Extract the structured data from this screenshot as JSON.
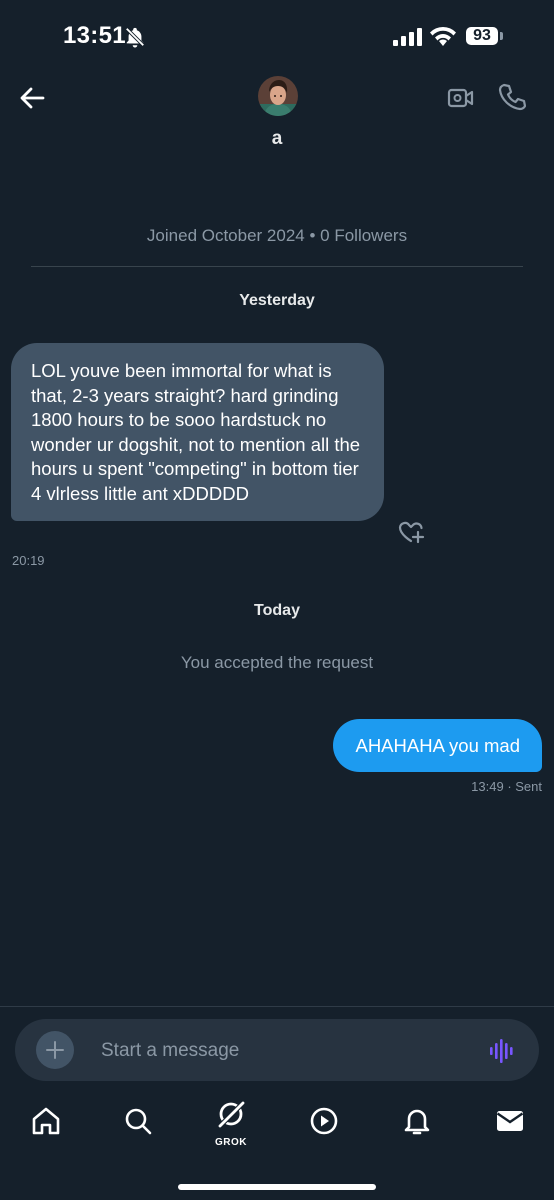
{
  "status_bar": {
    "time": "13:51",
    "battery": "93"
  },
  "header": {
    "contact_name": "a"
  },
  "profile": {
    "meta": "Joined October 2024 • 0 Followers"
  },
  "messages": [
    {
      "day_label": "Yesterday"
    },
    {
      "text": "LOL youve been immortal for what is that, 2-3 years straight? hard grinding 1800 hours to be sooo hardstuck no wonder ur dogshit, not to mention all the hours u spent \"competing\" in bottom tier 4 vlrless little ant xDDDDD",
      "time": "20:19"
    },
    {
      "day_label": "Today"
    },
    {
      "system": "You accepted the request"
    },
    {
      "text": "AHAHAHA you mad",
      "time": "13:49",
      "status": "· Sent"
    }
  ],
  "composer": {
    "placeholder": "Start a message"
  },
  "nav": {
    "grok_label": "GROK"
  },
  "colors": {
    "background": "#15202b",
    "accent": "#1d9bf0",
    "incoming_bubble": "#425466",
    "voice_accent": "#7856ff"
  },
  "icons": [
    "back-arrow-icon",
    "video-camera-icon",
    "phone-icon",
    "heart-plus-icon",
    "plus-icon",
    "voice-wave-icon",
    "home-icon",
    "search-icon",
    "grok-icon",
    "play-icon",
    "bell-icon",
    "mail-icon"
  ]
}
